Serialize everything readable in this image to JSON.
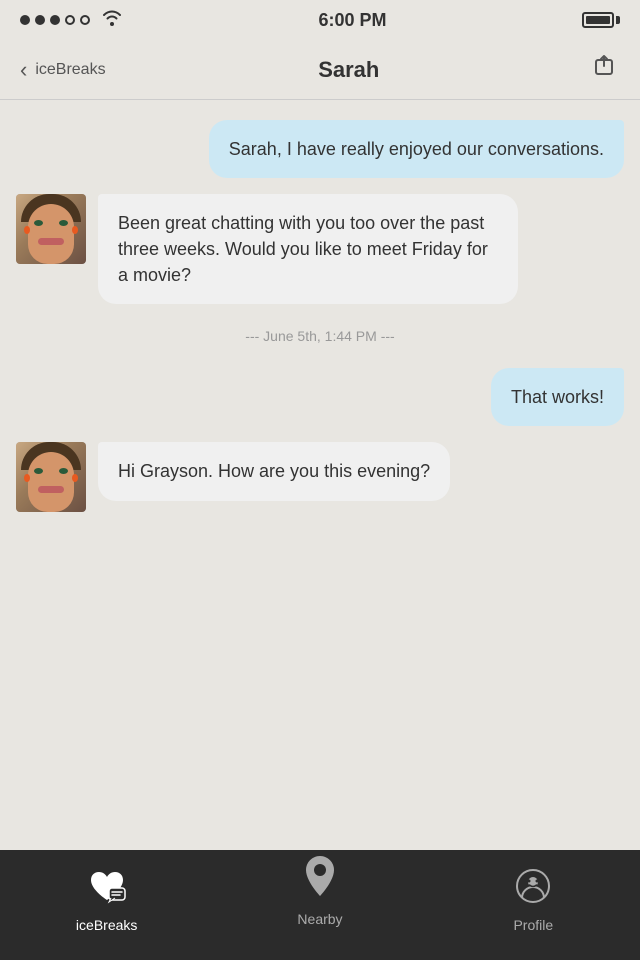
{
  "statusBar": {
    "time": "6:00 PM",
    "signalDots": 3,
    "emptyDots": 2
  },
  "navBar": {
    "backLabel": "iceBreaks",
    "title": "Sarah",
    "shareIcon": "share"
  },
  "messages": [
    {
      "id": 1,
      "type": "outgoing",
      "text": "Sarah, I have really enjoyed our conversations."
    },
    {
      "id": 2,
      "type": "incoming",
      "text": "Been great chatting with you too over the past three weeks. Would you like to meet Friday for a movie?"
    },
    {
      "id": 3,
      "type": "timestamp",
      "text": "--- June 5th, 1:44 PM ---"
    },
    {
      "id": 4,
      "type": "outgoing",
      "text": "That works!"
    },
    {
      "id": 5,
      "type": "incoming",
      "text": "Hi Grayson. How are you this evening?"
    }
  ],
  "tabBar": {
    "tabs": [
      {
        "id": "icebreaks",
        "label": "iceBreaks",
        "active": true
      },
      {
        "id": "nearby",
        "label": "Nearby",
        "active": false
      },
      {
        "id": "profile",
        "label": "Profile",
        "active": false
      }
    ]
  }
}
